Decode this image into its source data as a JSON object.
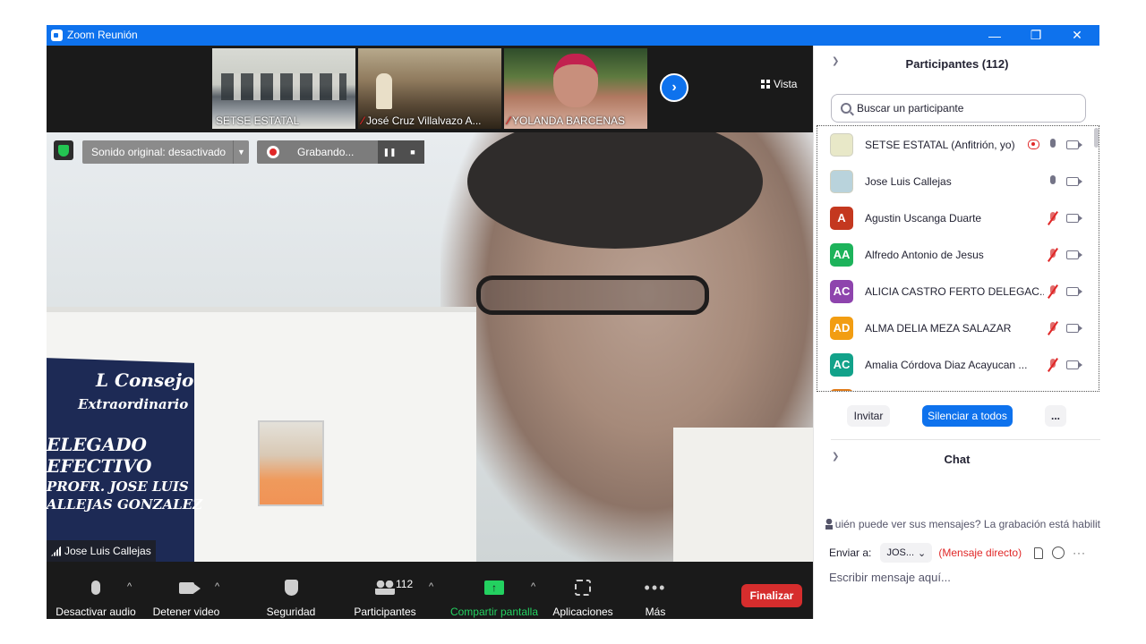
{
  "window": {
    "title": "Zoom Reunión"
  },
  "thumbnails": [
    {
      "name": "SETSE ESTATAL",
      "muted": false
    },
    {
      "name": "José Cruz Villalvazo A...",
      "muted": true
    },
    {
      "name": "YOLANDA BARCENAS",
      "muted": true
    }
  ],
  "view_label": "Vista",
  "overlays": {
    "sound_original": "Sonido original: desactivado",
    "recording": "Grabando..."
  },
  "main_video": {
    "speaker": "Jose Luis Callejas",
    "board": {
      "line1": "L Consejo",
      "line2": "Extraordinario",
      "line3": "ELEGADO EFECTIVO",
      "line4": "PROFR. JOSE LUIS",
      "line5": "ALLEJAS GONZALEZ"
    }
  },
  "toolbar": {
    "audio": "Desactivar audio",
    "video": "Detener video",
    "security": "Seguridad",
    "participants": "Participantes",
    "participants_count": "112",
    "share": "Compartir pantalla",
    "apps": "Aplicaciones",
    "more": "Más",
    "end": "Finalizar"
  },
  "participants_panel": {
    "title": "Participantes (112)",
    "search_placeholder": "Buscar un participante",
    "items": [
      {
        "name": "SETSE ESTATAL (Anfitrión, yo)",
        "avatar": "",
        "color": "#e8e8c8",
        "muted": false,
        "recording": true
      },
      {
        "name": "Jose Luis Callejas",
        "avatar": "",
        "color": "#b9d3dc",
        "muted": false,
        "recording": false
      },
      {
        "name": "Agustin Uscanga Duarte",
        "avatar": "A",
        "color": "#c4381f",
        "muted": true,
        "recording": false
      },
      {
        "name": "Alfredo Antonio de Jesus",
        "avatar": "AA",
        "color": "#1db35b",
        "muted": true,
        "recording": false
      },
      {
        "name": "ALICIA CASTRO FERTO DELEGAC...",
        "avatar": "AC",
        "color": "#8e44ad",
        "muted": true,
        "recording": false
      },
      {
        "name": "ALMA DELIA MEZA SALAZAR",
        "avatar": "AD",
        "color": "#f29d12",
        "muted": true,
        "recording": false
      },
      {
        "name": "Amalia Córdova Diaz Acayucan ...",
        "avatar": "AC",
        "color": "#12a28a",
        "muted": true,
        "recording": false
      }
    ],
    "invite": "Invitar",
    "mute_all": "Silenciar a todos",
    "more": "..."
  },
  "chat": {
    "title": "Chat",
    "notice": "uién puede ver sus mensajes? La grabación está habilit",
    "send_to_label": "Enviar a:",
    "recipient": "JOS...",
    "direct_message": "(Mensaje directo)",
    "input_placeholder": "Escribir mensaje aquí..."
  }
}
